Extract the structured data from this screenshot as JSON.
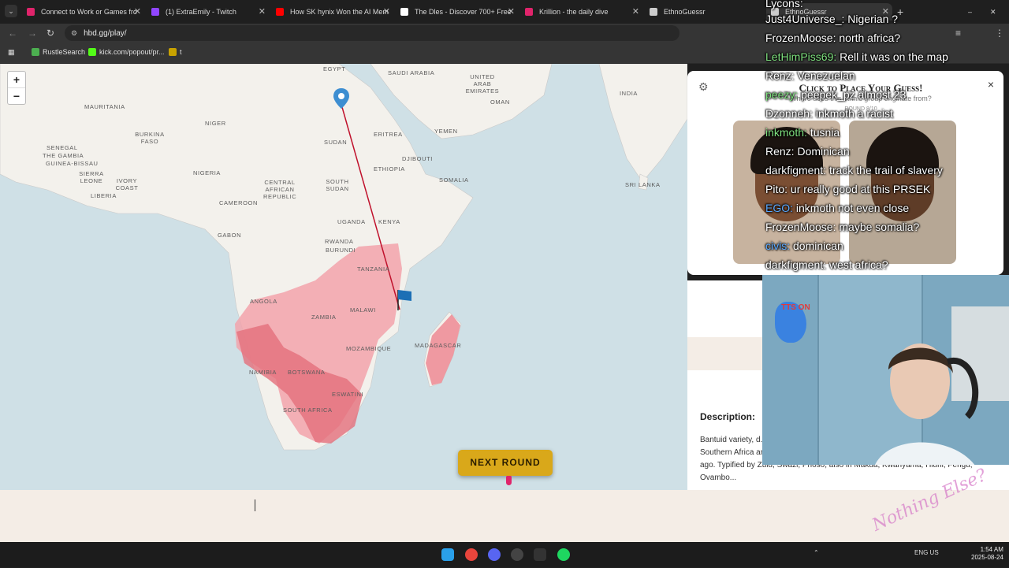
{
  "tabs": [
    {
      "label": "Connect to Work or Games fro",
      "color": "#e0246b"
    },
    {
      "label": "(1) ExtraEmily - Twitch",
      "color": "#9146ff"
    },
    {
      "label": "How SK hynix Won the AI Mem",
      "color": "#ff0000"
    },
    {
      "label": "The Dles - Discover 700+ Free",
      "color": "#ffffff"
    },
    {
      "label": "Krillion - the daily dive",
      "color": "#e0246b"
    },
    {
      "label": "EthnoGuessr",
      "color": "#cccccc"
    },
    {
      "label": "EthnoGuessr",
      "color": "#cccccc"
    }
  ],
  "address": {
    "url": "hbd.gg/play/"
  },
  "bookmarks": [
    {
      "label": "RustleSearch",
      "color": "#4caf50"
    },
    {
      "label": "kick.com/popout/pr...",
      "color": "#53fc18"
    },
    {
      "label": "t",
      "color": "#c8a200"
    }
  ],
  "map": {
    "countries": [
      "EGYPT",
      "SAUDI ARABIA",
      "UNITED ARAB EMIRATES",
      "OMAN",
      "INDIA",
      "MAURITANIA",
      "NIGER",
      "SUDAN",
      "ERITREA",
      "YEMEN",
      "BURKINA FASO",
      "NIGERIA",
      "ETHIOPIA",
      "DJIBOUTI",
      "SOMALIA",
      "SRI LANKA",
      "SENEGAL",
      "THE GAMBIA",
      "GUINEA-BISSAU",
      "SIERRA LEONE",
      "LIBERIA",
      "IVORY COAST",
      "CENTRAL AFRICAN REPUBLIC",
      "SOUTH SUDAN",
      "CAMEROON",
      "UGANDA",
      "KENYA",
      "GABON",
      "RWANDA",
      "BURUNDI",
      "TANZANIA",
      "ANGOLA",
      "ZAMBIA",
      "MALAWI",
      "MOZAMBIQUE",
      "MADAGASCAR",
      "NAMIBIA",
      "BOTSWANA",
      "ESWATINI",
      "SOUTH AFRICA"
    ],
    "zoom_in": "+",
    "zoom_out": "−",
    "next_round": "NEXT ROUND"
  },
  "guess_panel": {
    "title": "Click to Place Your Guess!",
    "question": "Where does this ethnic group originate from?",
    "round": "ROUND 8/10",
    "close": "×"
  },
  "info_panel": {
    "heading": "Description:",
    "text": "Bantuid variety, d... Especially found ... Swaziland, extends through many regions of Southern Africa and Madagascar. Originated from Bantu expansion some millennia ago. Typified by Zulu, Swazi, Phoso, also in Makua, Kwanyama, Hluhl, Fengu, Ovambo..."
  },
  "chat": [
    {
      "user": "Lycons:",
      "text": "",
      "color": "#ffffff"
    },
    {
      "user": "Just4Universe_:",
      "text": "Nigerian ?",
      "color": "#ffffff"
    },
    {
      "user": "FrozenMoose:",
      "text": "north africa?",
      "color": "#ffffff"
    },
    {
      "user": "LetHimPiss69:",
      "text": "Rell it was on the map",
      "color": "#7ee07e"
    },
    {
      "user": "Renz:",
      "text": "Venezuelan",
      "color": "#ffffff"
    },
    {
      "user": "peezy:",
      "text": "peepek_pz almost 23",
      "color": "#7ee07e"
    },
    {
      "user": "Dzonneh:",
      "text": "inkmoth a racist",
      "color": "#ffffff"
    },
    {
      "user": "inkmoth:",
      "text": "tusnia",
      "color": "#7ee07e"
    },
    {
      "user": "Renz:",
      "text": "Dominican",
      "color": "#ffffff"
    },
    {
      "user": "darkfigment:",
      "text": "track the trail of slavery",
      "color": "#ffffff"
    },
    {
      "user": "Pito:",
      "text": "ur really good at this PRSEK",
      "color": "#ffffff"
    },
    {
      "user": "EGO:",
      "text": "inkmoth not even close",
      "color": "#5aa9ff"
    },
    {
      "user": "FrozenMoose:",
      "text": "maybe somalia?",
      "color": "#ffffff"
    },
    {
      "user": "civis:",
      "text": "dominican",
      "color": "#5aa9ff"
    },
    {
      "user": "darkfigment:",
      "text": "west africa?",
      "color": "#ffffff"
    }
  ],
  "webcam": {
    "overlay": "TTS ON"
  },
  "taskbar": {
    "lang": "ENG US",
    "time": "1:54 AM",
    "date": "2025-08-24"
  },
  "watermark": "Nothing Else?"
}
